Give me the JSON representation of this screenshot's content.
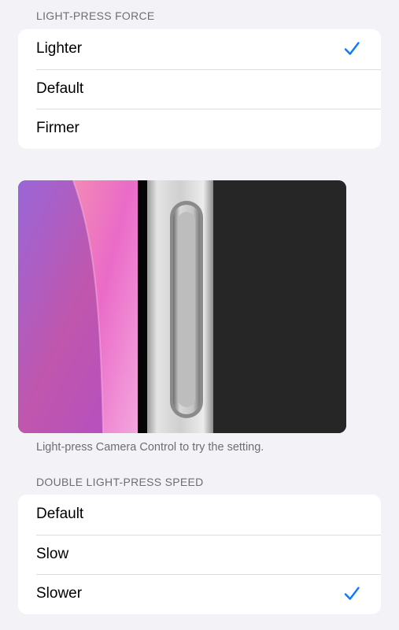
{
  "force_section": {
    "header": "LIGHT-PRESS FORCE",
    "options": [
      {
        "label": "Lighter",
        "selected": true
      },
      {
        "label": "Default",
        "selected": false
      },
      {
        "label": "Firmer",
        "selected": false
      }
    ]
  },
  "preview": {
    "caption": "Light-press Camera Control to try the setting."
  },
  "speed_section": {
    "header": "DOUBLE LIGHT-PRESS SPEED",
    "options": [
      {
        "label": "Default",
        "selected": false
      },
      {
        "label": "Slow",
        "selected": false
      },
      {
        "label": "Slower",
        "selected": true
      }
    ]
  },
  "colors": {
    "accent": "#0a7aff",
    "background": "#f2f2f7",
    "secondary_text": "#6d6d72"
  },
  "icons": {
    "selected": "checkmark-icon"
  }
}
